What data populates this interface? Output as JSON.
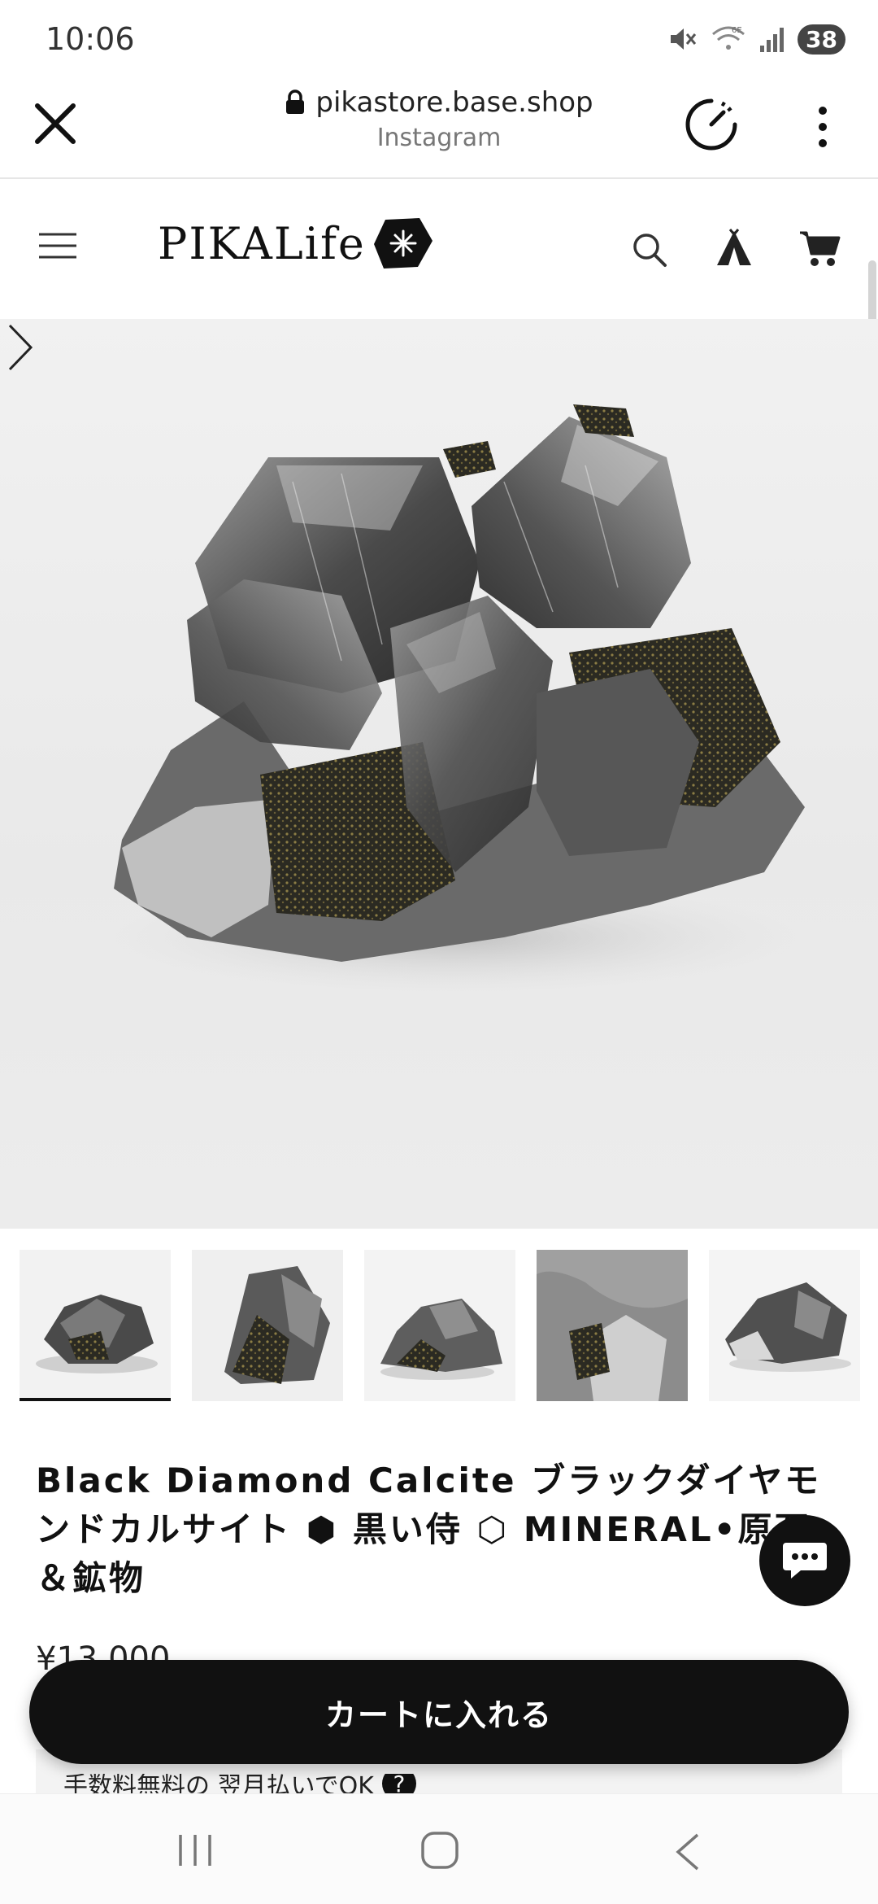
{
  "status_bar": {
    "time": "10:06",
    "battery": "38",
    "icons": [
      "mute-icon",
      "wifi-6e-icon",
      "signal-icon"
    ]
  },
  "browser": {
    "url": "pikastore.base.shop",
    "source": "Instagram",
    "icons": [
      "close-icon",
      "lock-icon",
      "speed-icon",
      "more-vertical-icon"
    ]
  },
  "site": {
    "logo_text": "PIKALife",
    "icons": [
      "menu-icon",
      "search-icon",
      "tent-icon",
      "cart-icon"
    ]
  },
  "product": {
    "title": "Black Diamond Calcite ブラックダイヤモンドカルサイト ⬢ 黒い侍 ⬡ MINERAL•原石＆鉱物",
    "price": "¥13,000",
    "add_to_cart": "カートに入れる",
    "payment_note": "手数料無料の 翌月払いでOK",
    "thumbnail_count": 5,
    "active_thumbnail": 1
  },
  "colors": {
    "accent": "#111111",
    "background": "#ffffff",
    "hero_background": "#ececec"
  }
}
